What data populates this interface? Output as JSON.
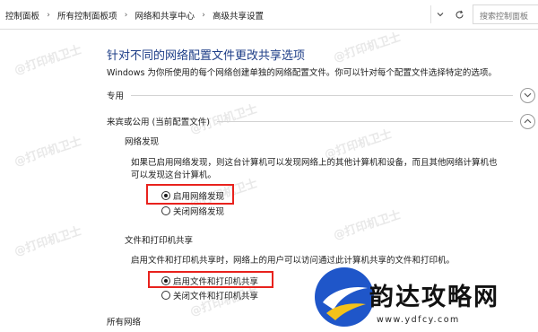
{
  "address_bar": {
    "breadcrumbs": [
      "控制面板",
      "所有控制面板项",
      "网络和共享中心",
      "高级共享设置"
    ],
    "search_placeholder": "搜索控制面板"
  },
  "main": {
    "title": "针对不同的网络配置文件更改共享选项",
    "description": "Windows 为你所使用的每个网络创建单独的网络配置文件。你可以针对每个配置文件选择特定的选项。",
    "profiles": {
      "private": {
        "label": "专用"
      },
      "guest_public": {
        "label": "来宾或公用 (当前配置文件)",
        "network_discovery": {
          "heading": "网络发现",
          "description_line1": "如果已启用网络发现，则这台计算机可以发现网络上的其他计算机和设备，而且其他网络计算机也",
          "description_line2": "可以发现这台计算机。",
          "options": [
            {
              "label": "启用网络发现",
              "selected": true
            },
            {
              "label": "关闭网络发现",
              "selected": false
            }
          ]
        },
        "file_printer_sharing": {
          "heading": "文件和打印机共享",
          "description": "启用文件和打印机共享时，网络上的用户可以访问通过此计算机共享的文件和打印机。",
          "options": [
            {
              "label": "启用文件和打印机共享",
              "selected": true
            },
            {
              "label": "关闭文件和打印机共享",
              "selected": false
            }
          ]
        }
      },
      "all_networks": {
        "label": "所有网络"
      }
    }
  },
  "watermark": {
    "text": "@打印机卫士"
  },
  "brand": {
    "name": "韵达攻略网",
    "url": "www.ydfcy.com"
  },
  "colors": {
    "title": "#1d3d87",
    "highlight": "#e8221d"
  }
}
